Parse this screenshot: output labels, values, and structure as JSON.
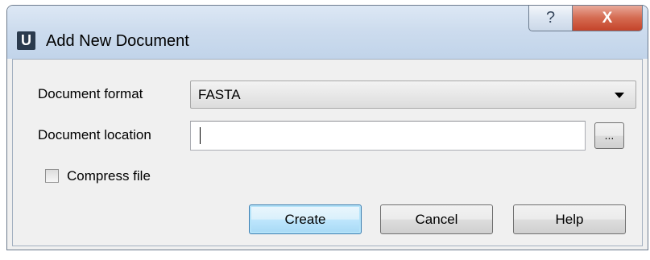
{
  "window": {
    "title": "Add New Document",
    "app_icon_letter": "U",
    "help_glyph": "?",
    "close_glyph": "X"
  },
  "form": {
    "format_label": "Document format",
    "format_value": "FASTA",
    "location_label": "Document location",
    "location_value": "",
    "browse_label": "...",
    "compress_label": "Compress file",
    "compress_checked": false
  },
  "buttons": {
    "create": "Create",
    "cancel": "Cancel",
    "help": "Help"
  },
  "colors": {
    "title_bar": "#c9dbee",
    "close_button": "#c4432a",
    "default_button_border": "#3c7fb1"
  }
}
